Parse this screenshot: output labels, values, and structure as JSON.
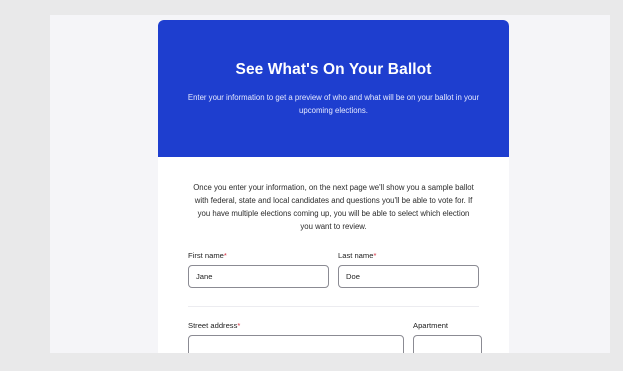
{
  "hero": {
    "title": "See What's On Your Ballot",
    "subtitle": "Enter your information to get a preview of who and what will be on your ballot in your upcoming elections."
  },
  "intro": "Once you enter your information, on the next page we'll show you a sample ballot with federal, state and local candidates and questions you'll be able to vote for. If you have multiple elections coming up, you will be able to select which election you want to review.",
  "form": {
    "first_name": {
      "label": "First name",
      "required_mark": "*",
      "value": "Jane"
    },
    "last_name": {
      "label": "Last name",
      "required_mark": "*",
      "value": "Doe"
    },
    "street_address": {
      "label": "Street address",
      "required_mark": "*",
      "value": ""
    },
    "apartment": {
      "label": "Apartment",
      "value": ""
    }
  },
  "colors": {
    "hero_bg": "#1e3ecf",
    "required": "#d22a3a",
    "page_bg": "#e9e9ea"
  }
}
